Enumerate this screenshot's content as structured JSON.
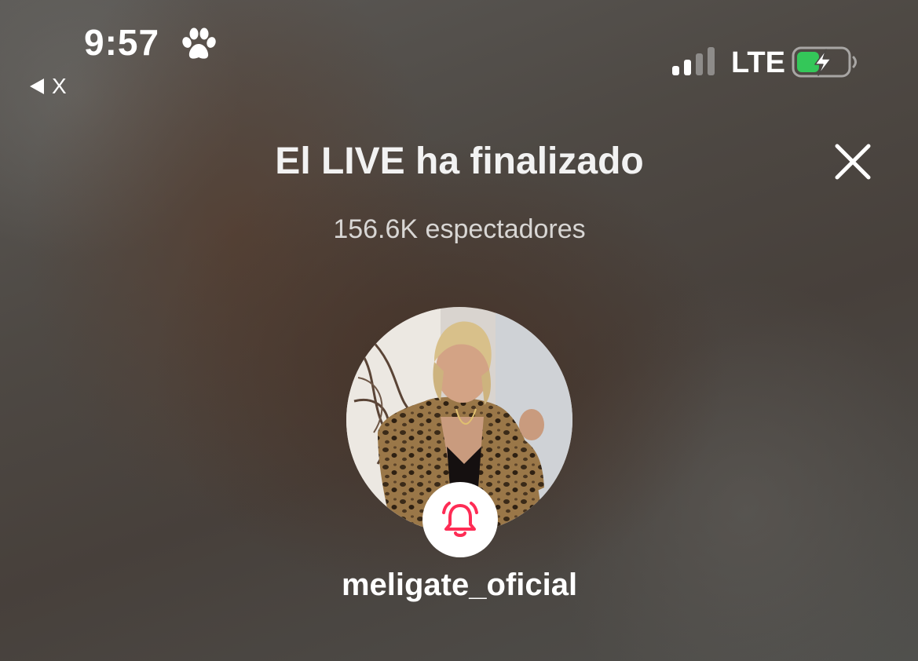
{
  "status_bar": {
    "time": "9:57",
    "back_label": "X",
    "carrier": "LTE",
    "icons": {
      "status_extra": "paw-icon",
      "signal": "signal-icon",
      "battery": "battery-charging-icon"
    },
    "battery_color": "#34c759",
    "battery_level": 0.45
  },
  "live_ended": {
    "title": "El LIVE ha finalizado",
    "viewers": "156.6K espectadores",
    "close_icon": "close-icon"
  },
  "profile": {
    "username": "meligate_oficial",
    "notify_icon": "bell-icon",
    "notify_color": "#fe2c55"
  }
}
